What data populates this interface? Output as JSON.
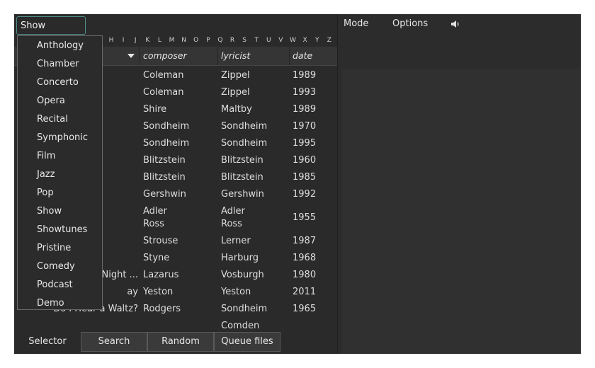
{
  "menubar": {
    "mode_label": "Mode",
    "options_label": "Options",
    "volume_icon": "speaker-icon"
  },
  "category_select": {
    "value": "Show"
  },
  "dropdown": {
    "options": [
      "Anthology",
      "Chamber",
      "Concerto",
      "Opera",
      "Recital",
      "Symphonic",
      "Film",
      "Jazz",
      "Pop",
      "Show",
      "Showtunes",
      "Pristine",
      "Comedy",
      "Podcast",
      "Demo"
    ]
  },
  "alphabet": [
    "H",
    "I",
    "J",
    "K",
    "L",
    "M",
    "N",
    "O",
    "P",
    "Q",
    "R",
    "S",
    "T",
    "U",
    "V",
    "W",
    "X",
    "Y",
    "Z"
  ],
  "table": {
    "columns": {
      "composer": "composer",
      "lyricist": "lyricist",
      "date": "date"
    },
    "rows": [
      {
        "title": "",
        "composer": "Coleman",
        "lyricist": "Zippel",
        "date": "1989"
      },
      {
        "title": "",
        "composer": "Coleman",
        "lyricist": "Zippel",
        "date": "1993"
      },
      {
        "title": "",
        "composer": "Shire",
        "lyricist": "Maltby",
        "date": "1989"
      },
      {
        "title": "",
        "composer": "Sondheim",
        "lyricist": "Sondheim",
        "date": "1970"
      },
      {
        "title": "",
        "composer": "Sondheim",
        "lyricist": "Sondheim",
        "date": "1995"
      },
      {
        "title": "",
        "composer": "Blitzstein",
        "lyricist": "Blitzstein",
        "date": "1960"
      },
      {
        "title": "",
        "composer": "Blitzstein",
        "lyricist": "Blitzstein",
        "date": "1985"
      },
      {
        "title": "",
        "composer": "Gershwin",
        "lyricist": "Gershwin",
        "date": "1992"
      },
      {
        "title": "",
        "composer": "Adler\nRoss",
        "lyricist": "Adler\nRoss",
        "date": "1955"
      },
      {
        "title": "",
        "composer": "Strouse",
        "lyricist": "Lerner",
        "date": "1987"
      },
      {
        "title": "",
        "composer": "Styne",
        "lyricist": "Harburg",
        "date": "1968"
      },
      {
        "title": "Night ...",
        "composer": "Lazarus",
        "lyricist": "Vosburgh",
        "date": "1980"
      },
      {
        "title": "ay",
        "composer": "Yeston",
        "lyricist": "Yeston",
        "date": "2011"
      },
      {
        "title": "Do I Hear a Waltz?",
        "composer": "Rodgers",
        "lyricist": "Sondheim",
        "date": "1965"
      },
      {
        "title": "",
        "composer": "",
        "lyricist": "Comden",
        "date": ""
      }
    ]
  },
  "tabs": [
    "Selector",
    "Search",
    "Random",
    "Queue files"
  ]
}
